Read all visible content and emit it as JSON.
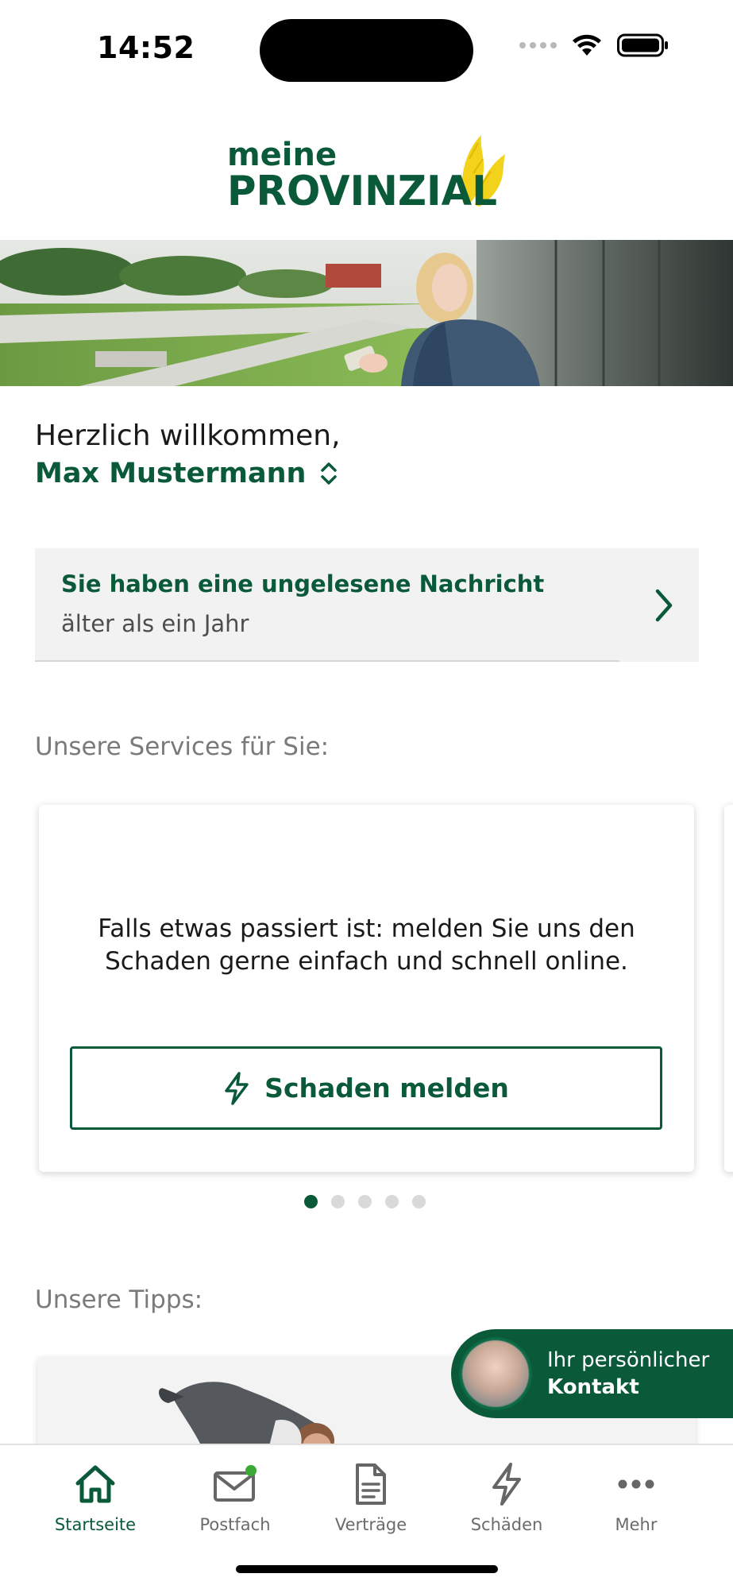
{
  "status_bar": {
    "time": "14:52",
    "icons": [
      "cellular-signal-icon",
      "wifi-icon",
      "battery-icon"
    ]
  },
  "logo": {
    "line1": "meine",
    "line2": "PROVINZIAL"
  },
  "welcome": {
    "greeting": "Herzlich willkommen,",
    "user_name": "Max Mustermann"
  },
  "message": {
    "title": "Sie haben eine ungelesene Nachricht",
    "subtitle": "älter als ein Jahr"
  },
  "services": {
    "title": "Unsere Services für Sie:",
    "card_text": "Falls etwas passiert ist: melden Sie uns den Schaden gerne einfach und schnell online.",
    "button_label": "Schaden melden",
    "pager": {
      "pages": 5,
      "active": 0
    }
  },
  "tips": {
    "title": "Unsere Tipps:"
  },
  "contact": {
    "line1": "Ihr persönlicher",
    "line2": "Kontakt"
  },
  "tab_bar": {
    "items": [
      {
        "label": "Startseite",
        "icon": "home-icon",
        "active": true
      },
      {
        "label": "Postfach",
        "icon": "mail-icon",
        "active": false,
        "badge": true
      },
      {
        "label": "Verträge",
        "icon": "document-icon",
        "active": false
      },
      {
        "label": "Schäden",
        "icon": "lightning-icon",
        "active": false
      },
      {
        "label": "Mehr",
        "icon": "more-icon",
        "active": false
      }
    ]
  },
  "colors": {
    "brand_green": "#0a5a3a",
    "brand_yellow": "#f2d21b",
    "badge_green": "#3aaa35"
  }
}
